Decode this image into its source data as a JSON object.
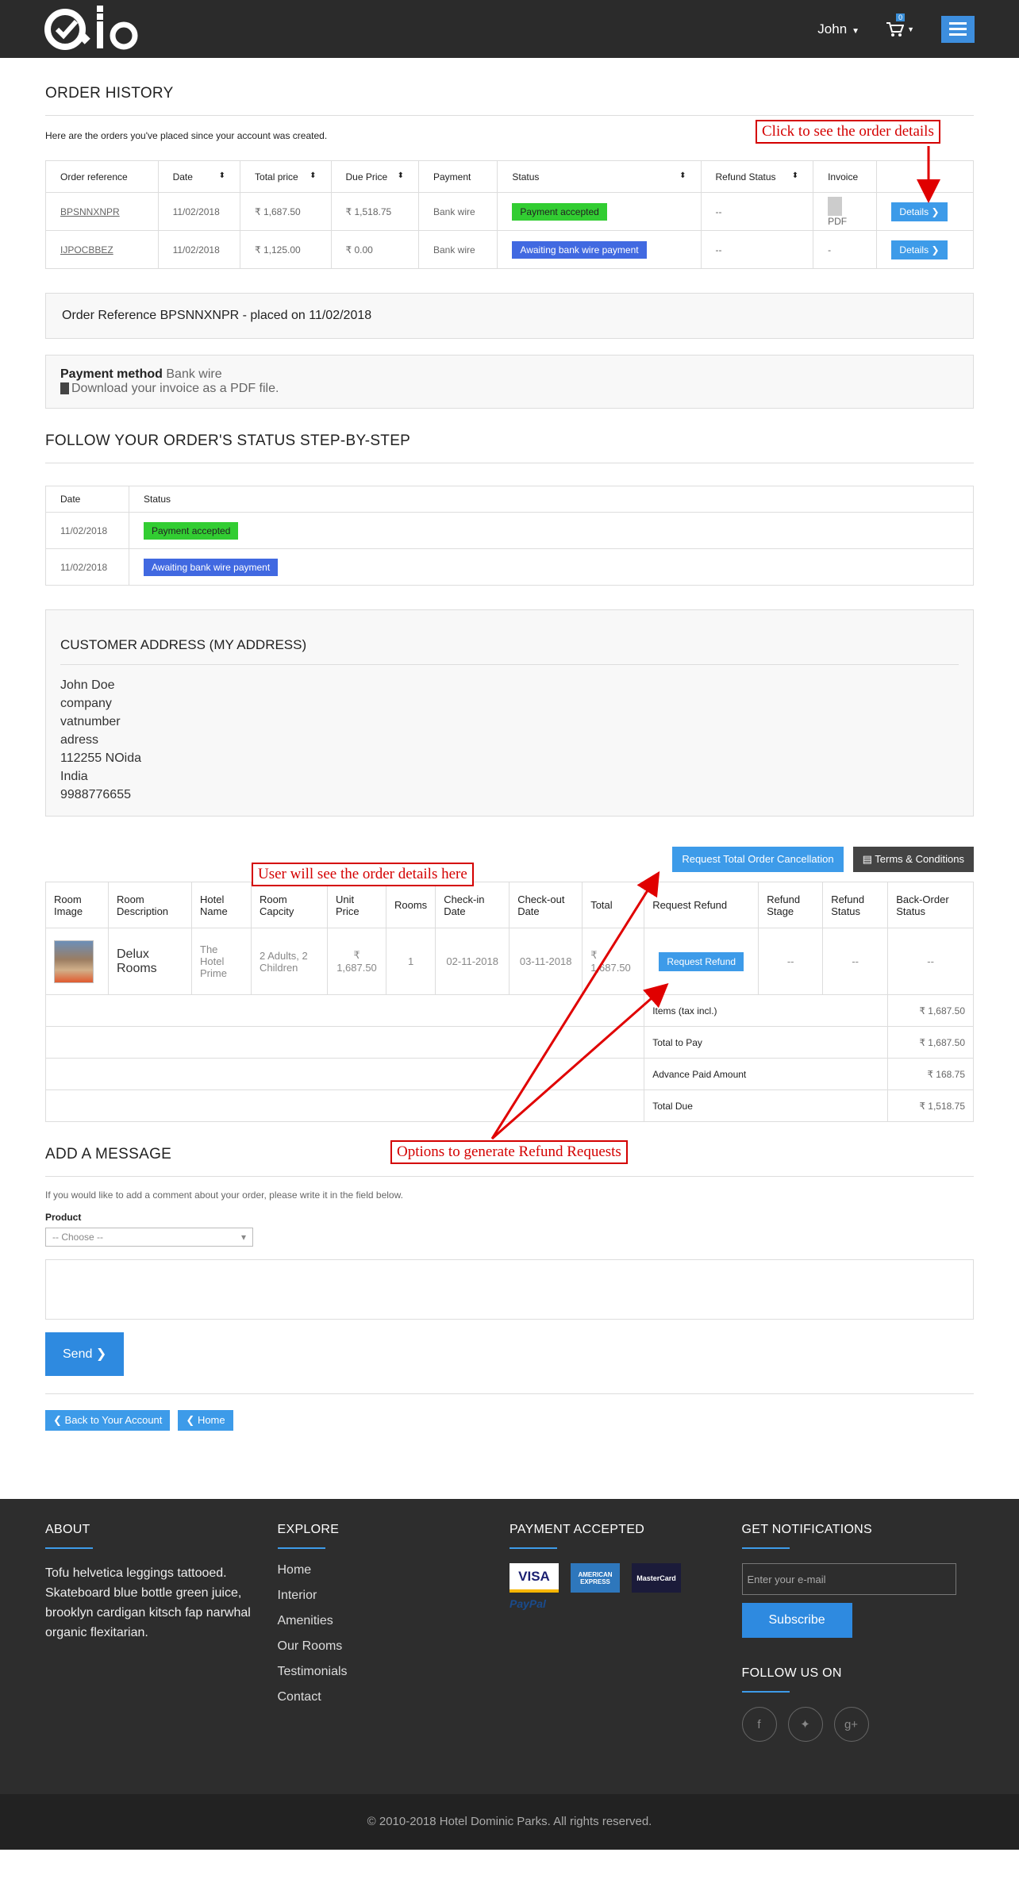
{
  "header": {
    "user_name": "John",
    "cart_count": "0",
    "colors": {
      "topbar": "#2b2b2b",
      "accent": "#3d8ede"
    }
  },
  "page": {
    "title": "ORDER HISTORY",
    "intro": "Here are the orders you've placed since your account was created."
  },
  "orders": {
    "columns": [
      "Order reference",
      "Date",
      "Total price",
      "Due Price",
      "Payment",
      "Status",
      "Refund Status",
      "Invoice",
      ""
    ],
    "rows": [
      {
        "ref": "BPSNNXNPR",
        "date": "11/02/2018",
        "total": "₹ 1,687.50",
        "due": "₹ 1,518.75",
        "payment": "Bank wire",
        "status": "Payment accepted",
        "refund": "--",
        "invoice": "PDF",
        "action": "Details"
      },
      {
        "ref": "IJPOCBBEZ",
        "date": "11/02/2018",
        "total": "₹ 1,125.00",
        "due": "₹ 0.00",
        "payment": "Bank wire",
        "status": "Awaiting bank wire payment",
        "refund": "--",
        "invoice": "-",
        "action": "Details"
      }
    ]
  },
  "order_ref": "Order Reference BPSNNXNPR - placed on 11/02/2018",
  "payment_box": {
    "label": "Payment method",
    "value": "Bank wire",
    "download": "Download your invoice as a PDF file."
  },
  "status_section": {
    "title": "FOLLOW YOUR ORDER'S STATUS STEP-BY-STEP",
    "columns": [
      "Date",
      "Status"
    ],
    "rows": [
      {
        "date": "11/02/2018",
        "status": "Payment accepted"
      },
      {
        "date": "11/02/2018",
        "status": "Awaiting bank wire payment"
      }
    ]
  },
  "address": {
    "title": "CUSTOMER ADDRESS (MY ADDRESS)",
    "lines": [
      "John Doe",
      "company",
      "vatnumber",
      "adress",
      "112255 NOida",
      "India",
      "9988776655"
    ]
  },
  "room_actions": {
    "cancel": "Request Total Order Cancellation",
    "terms": "Terms & Conditions"
  },
  "rooms": {
    "columns": [
      "Room Image",
      "Room Description",
      "Hotel Name",
      "Room Capcity",
      "Unit Price",
      "Rooms",
      "Check-in Date",
      "Check-out Date",
      "Total",
      "Request Refund",
      "Refund Stage",
      "Refund Status",
      "Back-Order Status"
    ],
    "row": {
      "description": "Delux Rooms",
      "hotel": "The Hotel Prime",
      "capacity": "2 Adults, 2 Children",
      "unit_price": "₹ 1,687.50",
      "rooms": "1",
      "checkin": "02-11-2018",
      "checkout": "03-11-2018",
      "total": "₹ 1,687.50",
      "refund_button": "Request Refund",
      "refund_stage": "--",
      "refund_status": "--",
      "backorder": "--"
    },
    "summary": [
      {
        "label": "Items (tax incl.)",
        "value": "₹ 1,687.50"
      },
      {
        "label": "Total to Pay",
        "value": "₹ 1,687.50"
      },
      {
        "label": "Advance Paid Amount",
        "value": "₹ 168.75"
      },
      {
        "label": "Total Due",
        "value": "₹ 1,518.75"
      }
    ]
  },
  "message": {
    "title": "ADD A MESSAGE",
    "intro": "If you would like to add a comment about your order, please write it in the field below.",
    "product_label": "Product",
    "product_placeholder": "-- Choose --",
    "send": "Send"
  },
  "nav": {
    "back": "Back to Your Account",
    "home": "Home"
  },
  "annotations": {
    "details": "Click to see the order details",
    "order_details": "User will see the order details here",
    "refund": "Options to generate Refund Requests"
  },
  "footer": {
    "about_title": "ABOUT",
    "about_text": "Tofu helvetica leggings tattooed. Skateboard blue bottle green juice, brooklyn cardigan kitsch fap narwhal organic flexitarian.",
    "explore_title": "EXPLORE",
    "explore_links": [
      "Home",
      "Interior",
      "Amenities",
      "Our Rooms",
      "Testimonials",
      "Contact"
    ],
    "payment_title": "PAYMENT ACCEPTED",
    "cards": [
      "VISA",
      "AMERICAN EXPRESS",
      "MasterCard"
    ],
    "paypal": "PayPal",
    "notify_title": "GET NOTIFICATIONS",
    "email_placeholder": "Enter your e-mail",
    "subscribe": "Subscribe",
    "follow_title": "FOLLOW US ON",
    "copyright": "© 2010-2018  Hotel Dominic Parks.  All rights reserved."
  }
}
